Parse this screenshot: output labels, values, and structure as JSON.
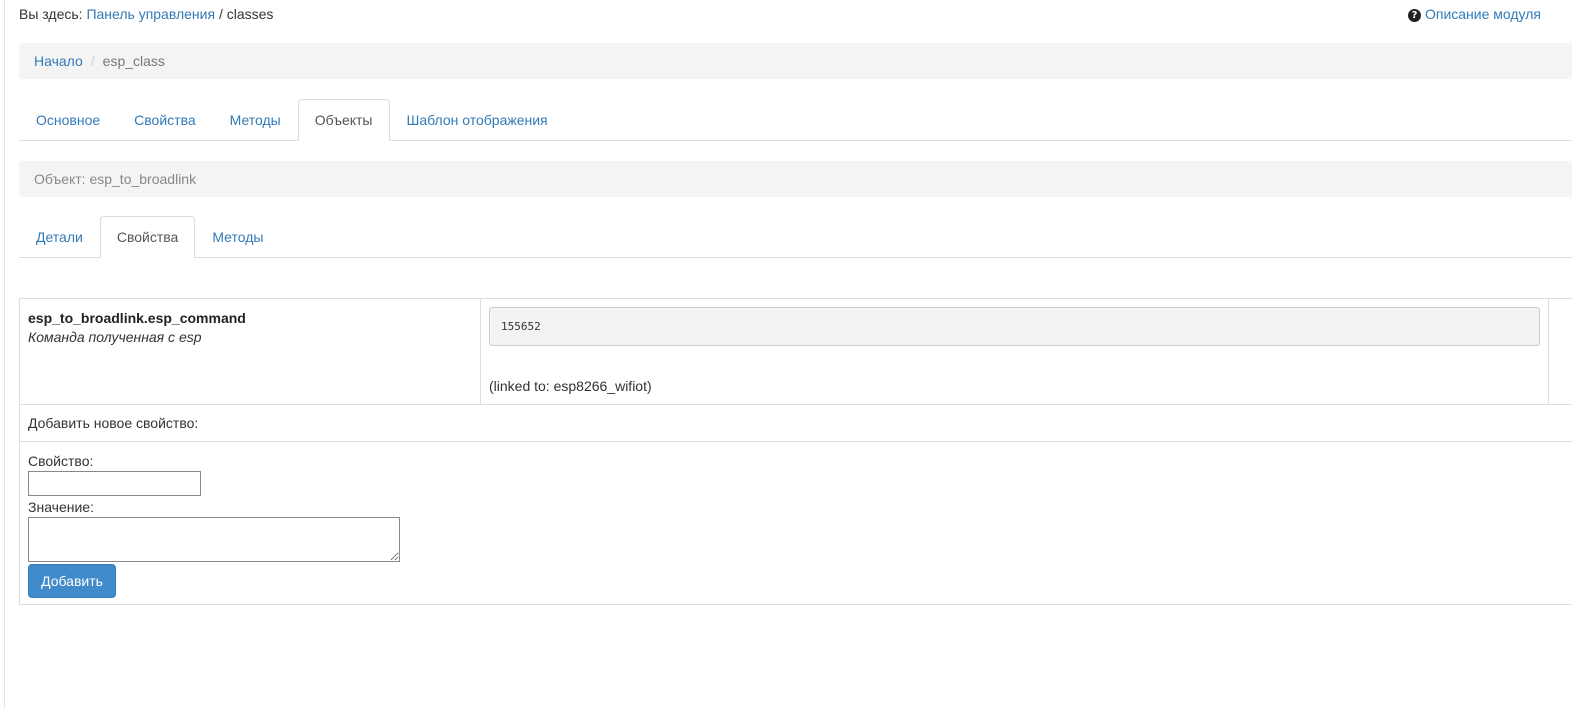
{
  "topline": {
    "prefix": "Вы здесь:",
    "link": "Панель управления",
    "separator": "/",
    "current": "classes"
  },
  "module_help": {
    "icon": "question-circle-icon",
    "label": "Описание модуля"
  },
  "breadcrumb": {
    "home": "Начало",
    "separator": "/",
    "current": "esp_class"
  },
  "main_tabs": [
    {
      "label": "Основное",
      "active": false
    },
    {
      "label": "Свойства",
      "active": false
    },
    {
      "label": "Методы",
      "active": false
    },
    {
      "label": "Объекты",
      "active": true
    },
    {
      "label": "Шаблон отображения",
      "active": false
    }
  ],
  "object_bar": {
    "text": "Объект: esp_to_broadlink"
  },
  "object_tabs": [
    {
      "label": "Детали",
      "active": false
    },
    {
      "label": "Свойства",
      "active": true
    },
    {
      "label": "Методы",
      "active": false
    }
  ],
  "properties": [
    {
      "name": "esp_to_broadlink.esp_command",
      "description": "Команда полученная с esp",
      "value": "155652",
      "linked": "(linked to: esp8266_wifiot)"
    }
  ],
  "add_property": {
    "header": "Добавить новое свойство:",
    "property_label": "Свойство:",
    "property_value": "",
    "value_label": "Значение:",
    "value_value": "",
    "button_label": "Добавить"
  },
  "colors": {
    "link": "#337ab7",
    "button": "#428bca",
    "bar_bg": "#f4f4f4",
    "border": "#dddddd"
  }
}
